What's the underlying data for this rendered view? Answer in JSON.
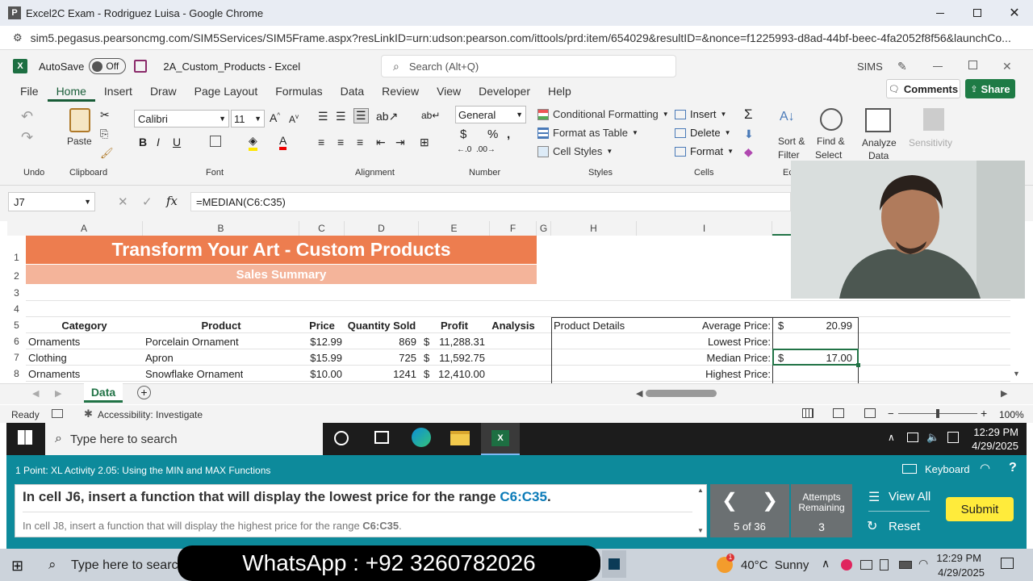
{
  "chrome": {
    "title": "Excel2C Exam - Rodriguez Luisa - Google Chrome",
    "url": "sim5.pegasus.pearsoncmg.com/SIM5Services/SIM5Frame.aspx?resLinkID=urn:udson:pearson.com/ittools/prd:item/654029&resultID=&nonce=f1225993-d8ad-44bf-beec-4fa2052f8f56&launchCo..."
  },
  "excel": {
    "autosave_label": "AutoSave",
    "autosave_state": "Off",
    "file_name": "2A_Custom_Products - Excel",
    "search_placeholder": "Search (Alt+Q)",
    "sims_label": "SIMS",
    "comments_label": "Comments",
    "share_label": "Share",
    "tabs": [
      "File",
      "Home",
      "Insert",
      "Draw",
      "Page Layout",
      "Formulas",
      "Data",
      "Review",
      "View",
      "Developer",
      "Help"
    ],
    "ribbon": {
      "paste": "Paste",
      "font_name": "Calibri",
      "font_size": "11",
      "number_format": "General",
      "conditional_formatting": "Conditional Formatting",
      "format_as_table": "Format as Table",
      "cell_styles": "Cell Styles",
      "insert": "Insert",
      "delete": "Delete",
      "format": "Format",
      "sort_filter_1": "Sort &",
      "sort_filter_2": "Filter",
      "find_select_1": "Find &",
      "find_select_2": "Select",
      "analyze_1": "Analyze",
      "analyze_2": "Data",
      "sensitivity": "Sensitivity",
      "groups": [
        "Undo",
        "Clipboard",
        "Font",
        "Alignment",
        "Number",
        "Styles",
        "Cells",
        "Ec"
      ]
    },
    "name_box": "J7",
    "formula": "=MEDIAN(C6:C35)",
    "columns": [
      "A",
      "B",
      "C",
      "D",
      "E",
      "F",
      "G",
      "H",
      "I"
    ],
    "rows": [
      "1",
      "2",
      "3",
      "4",
      "5",
      "6",
      "7",
      "8"
    ],
    "sheet": {
      "title": "Transform Your Art - Custom Products",
      "subtitle": "Sales Summary",
      "headers": [
        "Category",
        "Product",
        "Price",
        "Quantity Sold",
        "Profit",
        "Analysis"
      ],
      "data": [
        {
          "category": "Ornaments",
          "product": "Porcelain Ornament",
          "price": "$12.99",
          "qty": "869",
          "profit_sym": "$",
          "profit": "11,288.31"
        },
        {
          "category": "Clothing",
          "product": "Apron",
          "price": "$15.99",
          "qty": "725",
          "profit_sym": "$",
          "profit": "11,592.75"
        },
        {
          "category": "Ornaments",
          "product": "Snowflake Ornament",
          "price": "$10.00",
          "qty": "1241",
          "profit_sym": "$",
          "profit": "12,410.00"
        }
      ],
      "product_details": "Product Details",
      "stats": [
        {
          "label": "Average Price:",
          "sym": "$",
          "value": "20.99"
        },
        {
          "label": "Lowest Price:",
          "sym": "",
          "value": ""
        },
        {
          "label": "Median Price:",
          "sym": "$",
          "value": "17.00"
        },
        {
          "label": "Highest Price:",
          "sym": "",
          "value": ""
        }
      ]
    },
    "sheet_tab": "Data",
    "status_ready": "Ready",
    "accessibility": "Accessibility: Investigate",
    "zoom": "100%"
  },
  "taskbar_inner": {
    "search": "Type here to search",
    "time": "12:29 PM",
    "date": "4/29/2025"
  },
  "sim": {
    "header": "1 Point: XL Activity 2.05: Using the MIN and MAX Functions",
    "keyboard": "Keyboard",
    "instruction_main": "In cell J6, insert a function that will display the lowest price for the range ",
    "instruction_main_range": "C6:C35",
    "instruction_main_end": ".",
    "instruction_next": "In cell J8, insert a function that will display the highest price for the range ",
    "instruction_next_range": "C6:C35",
    "instruction_next_end": ".",
    "progress": "5 of 36",
    "attempts_label_1": "Attempts",
    "attempts_label_2": "Remaining",
    "attempts_value": "3",
    "view_all": "View All",
    "reset": "Reset",
    "submit": "Submit"
  },
  "taskbar": {
    "search": "Type here to search",
    "whatsapp": "WhatsApp : +92 3260782026",
    "weather": "40°C  Sunny",
    "weather_badge": "1",
    "time": "12:29 PM",
    "date": "4/29/2025"
  },
  "colors": {
    "excel_green": "#185c37",
    "title_orange": "#ed7d4f",
    "subtitle_orange": "#f4b49a",
    "sim_teal": "#0d8a9b",
    "submit_yellow": "#ffeb3b",
    "range_blue": "#0b7bb8"
  }
}
